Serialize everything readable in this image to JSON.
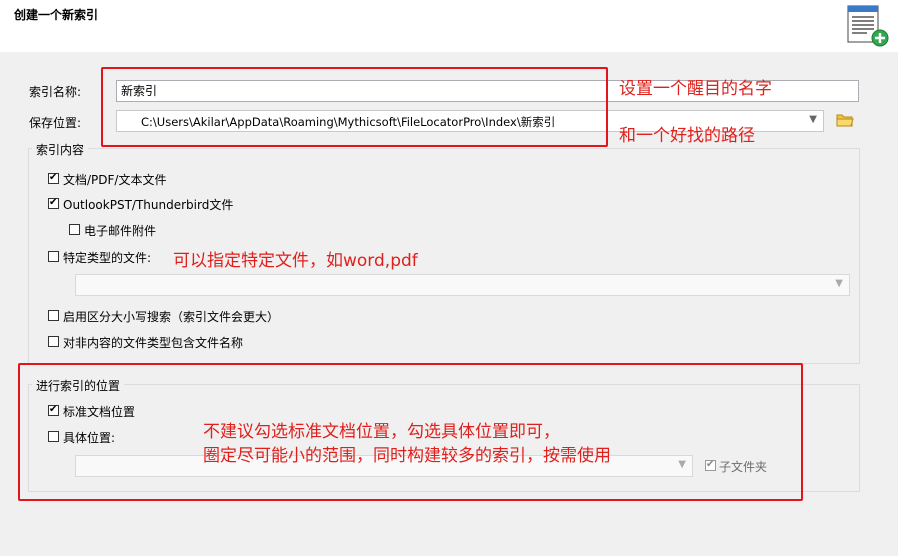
{
  "dialog": {
    "title": "创建一个新索引",
    "icon": "new-index-document-icon"
  },
  "form": {
    "index_name_label": "索引名称:",
    "index_name_value": "新索引",
    "save_location_label": "保存位置:",
    "save_location_value": "C:\\Users\\Akilar\\AppData\\Roaming\\Mythicsoft\\FileLocatorPro\\Index\\新索引",
    "browse_icon": "folder-icon"
  },
  "index_content": {
    "title": "索引内容",
    "options": [
      {
        "label": "文档/PDF/文本文件",
        "checked": true
      },
      {
        "label": "OutlookPST/Thunderbird文件",
        "checked": true
      },
      {
        "label": "电子邮件附件",
        "checked": false
      },
      {
        "label": "特定类型的文件:",
        "checked": false
      },
      {
        "label": "启用区分大小写搜索（索引文件会更大）",
        "checked": false
      },
      {
        "label": "对非内容的文件类型包含文件名称",
        "checked": false
      }
    ],
    "specific_types_value": ""
  },
  "index_location": {
    "title": "进行索引的位置",
    "options": [
      {
        "label": "标准文档位置",
        "checked": true
      },
      {
        "label": "具体位置:",
        "checked": false
      }
    ],
    "specific_location_value": "",
    "subfolders_label": "子文件夹",
    "subfolders_checked": true
  },
  "annotations": {
    "name_hint": "设置一个醒目的名字",
    "path_hint": "和一个好找的路径",
    "types_hint": "可以指定特定文件，如word,pdf",
    "location_hint_line1": "不建议勾选标准文档位置，勾选具体位置即可，",
    "location_hint_line2": "圈定尽可能小的范围，同时构建较多的索引，按需使用",
    "color": "#e0201d"
  }
}
